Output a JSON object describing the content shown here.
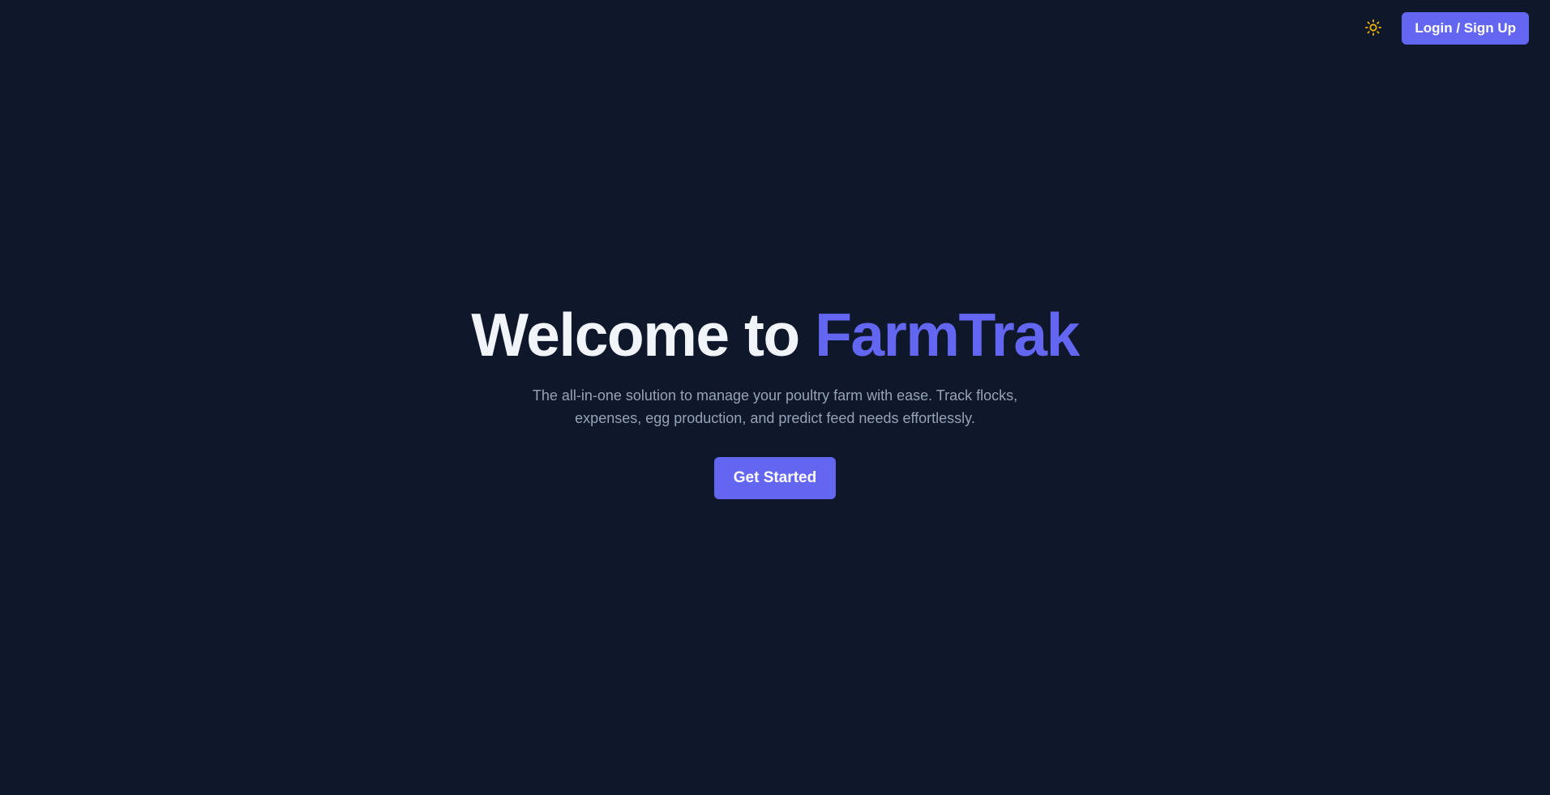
{
  "header": {
    "theme_toggle_icon": "sun-icon",
    "login_label": "Login / Sign Up"
  },
  "hero": {
    "title_prefix": "Welcome to ",
    "title_brand": "FarmTrak",
    "subtitle": "The all-in-one solution to manage your poultry farm with ease. Track flocks, expenses, egg production, and predict feed needs effortlessly.",
    "cta_label": "Get Started"
  },
  "colors": {
    "background": "#0f172a",
    "accent": "#6366f1",
    "title_text": "#f1f5f9",
    "subtitle_text": "#94a3b8",
    "sun_icon": "#eab308"
  }
}
